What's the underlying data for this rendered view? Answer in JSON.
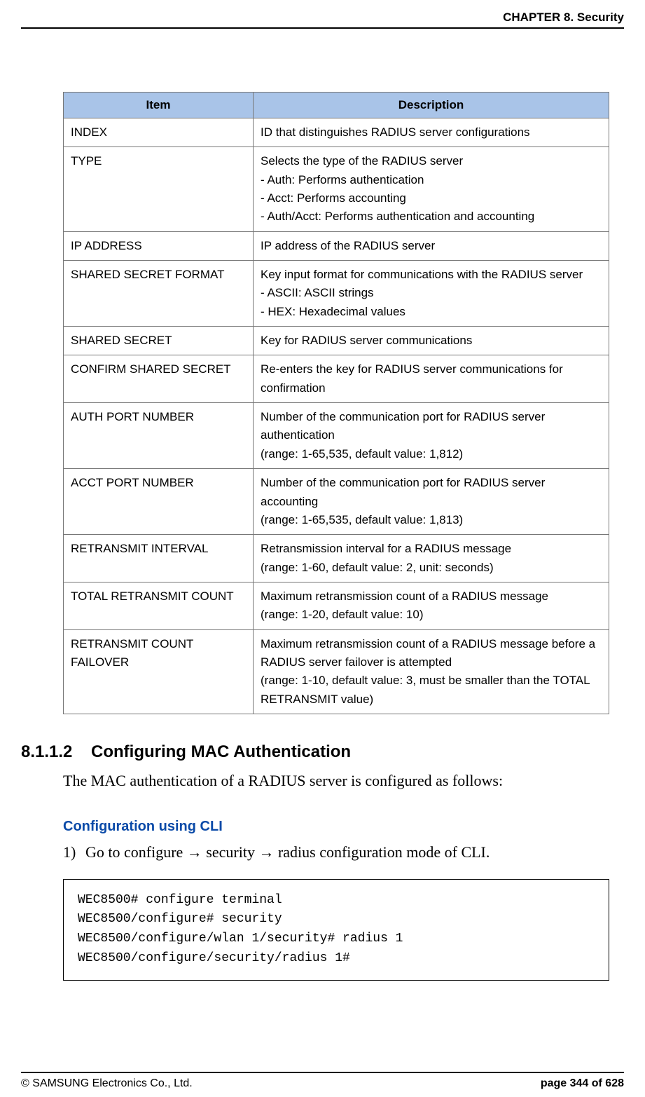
{
  "header": {
    "chapter": "CHAPTER 8. Security"
  },
  "table": {
    "headItem": "Item",
    "headDesc": "Description",
    "rows": [
      {
        "item": "INDEX",
        "desc": "ID that distinguishes RADIUS server configurations"
      },
      {
        "item": "TYPE",
        "desc": "Selects the type of the RADIUS server\n- Auth: Performs authentication\n- Acct: Performs accounting\n- Auth/Acct: Performs authentication and accounting"
      },
      {
        "item": "IP ADDRESS",
        "desc": "IP address of the RADIUS server"
      },
      {
        "item": "SHARED SECRET FORMAT",
        "desc": "Key input format for communications with the RADIUS server\n- ASCII: ASCII strings\n- HEX: Hexadecimal values"
      },
      {
        "item": "SHARED SECRET",
        "desc": "Key for RADIUS server communications"
      },
      {
        "item": "CONFIRM SHARED SECRET",
        "desc": "Re-enters the key for RADIUS server communications for confirmation"
      },
      {
        "item": "AUTH PORT NUMBER",
        "desc": "Number of the communication port for RADIUS server authentication\n(range: 1-65,535, default value: 1,812)"
      },
      {
        "item": "ACCT PORT NUMBER",
        "desc": "Number of the communication port for RADIUS server accounting\n(range: 1-65,535, default value: 1,813)"
      },
      {
        "item": "RETRANSMIT INTERVAL",
        "desc": "Retransmission interval for a RADIUS message\n(range: 1-60, default value: 2, unit: seconds)"
      },
      {
        "item": "TOTAL RETRANSMIT COUNT",
        "desc": "Maximum retransmission count of a RADIUS message\n(range: 1-20, default value: 10)"
      },
      {
        "item": "RETRANSMIT COUNT FAILOVER",
        "desc": "Maximum retransmission count of a RADIUS message before a RADIUS server failover is attempted\n(range: 1-10, default value: 3, must be smaller than the TOTAL RETRANSMIT value)"
      }
    ]
  },
  "section": {
    "number": "8.1.1.2",
    "title": "Configuring MAC Authentication",
    "intro": "The MAC authentication of a RADIUS server is configured as follows:",
    "subheading": "Configuration using CLI",
    "stepNum": "1)",
    "stepPrefix": "Go to configure ",
    "stepMid1": " security ",
    "stepSuffix": " radius configuration mode of CLI.",
    "arrow": "→"
  },
  "code": "WEC8500# configure terminal \nWEC8500/configure# security \nWEC8500/configure/wlan 1/security# radius 1 \nWEC8500/configure/security/radius 1# ",
  "footer": {
    "copyright": "© SAMSUNG Electronics Co., Ltd.",
    "page": "page 344 of 628"
  }
}
